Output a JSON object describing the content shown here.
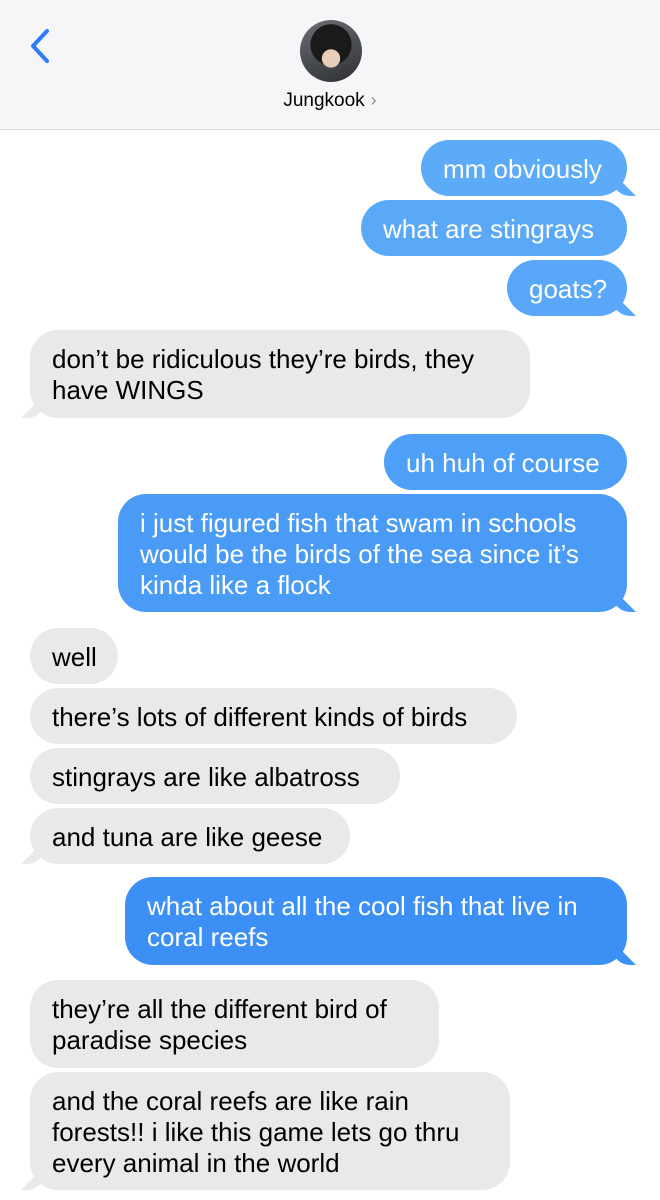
{
  "header": {
    "contact_name": "Jungkook",
    "chevron": "›",
    "back_icon": "chevron-left-icon",
    "accent_color": "#2f7cf6"
  },
  "colors": {
    "outgoing_light": "#5aa8f7",
    "outgoing_dark": "#3386f4",
    "incoming": "#e9e9eb"
  },
  "messages": [
    {
      "dir": "out",
      "text": "mm obviously"
    },
    {
      "dir": "out",
      "text": "what are stingrays"
    },
    {
      "dir": "out",
      "text": "goats?"
    },
    {
      "dir": "in",
      "text": "don’t be ridiculous they’re birds, they\nhave WINGS"
    },
    {
      "dir": "out",
      "text": "uh huh of course"
    },
    {
      "dir": "out",
      "text": "i just figured fish that swam in schools\nwould be the birds of the sea since it’s\nkinda like a flock"
    },
    {
      "dir": "in",
      "text": "well"
    },
    {
      "dir": "in",
      "text": "there’s lots of different kinds of birds"
    },
    {
      "dir": "in",
      "text": "stingrays are like albatross"
    },
    {
      "dir": "in",
      "text": "and tuna are like geese"
    },
    {
      "dir": "out",
      "text": "what about all the cool fish that live in\ncoral reefs"
    },
    {
      "dir": "in",
      "text": "they’re all the different bird of\nparadise species"
    },
    {
      "dir": "in",
      "text": "and the coral reefs are like rain\nforests!! i like this game lets go thru\nevery animal in the world"
    }
  ]
}
